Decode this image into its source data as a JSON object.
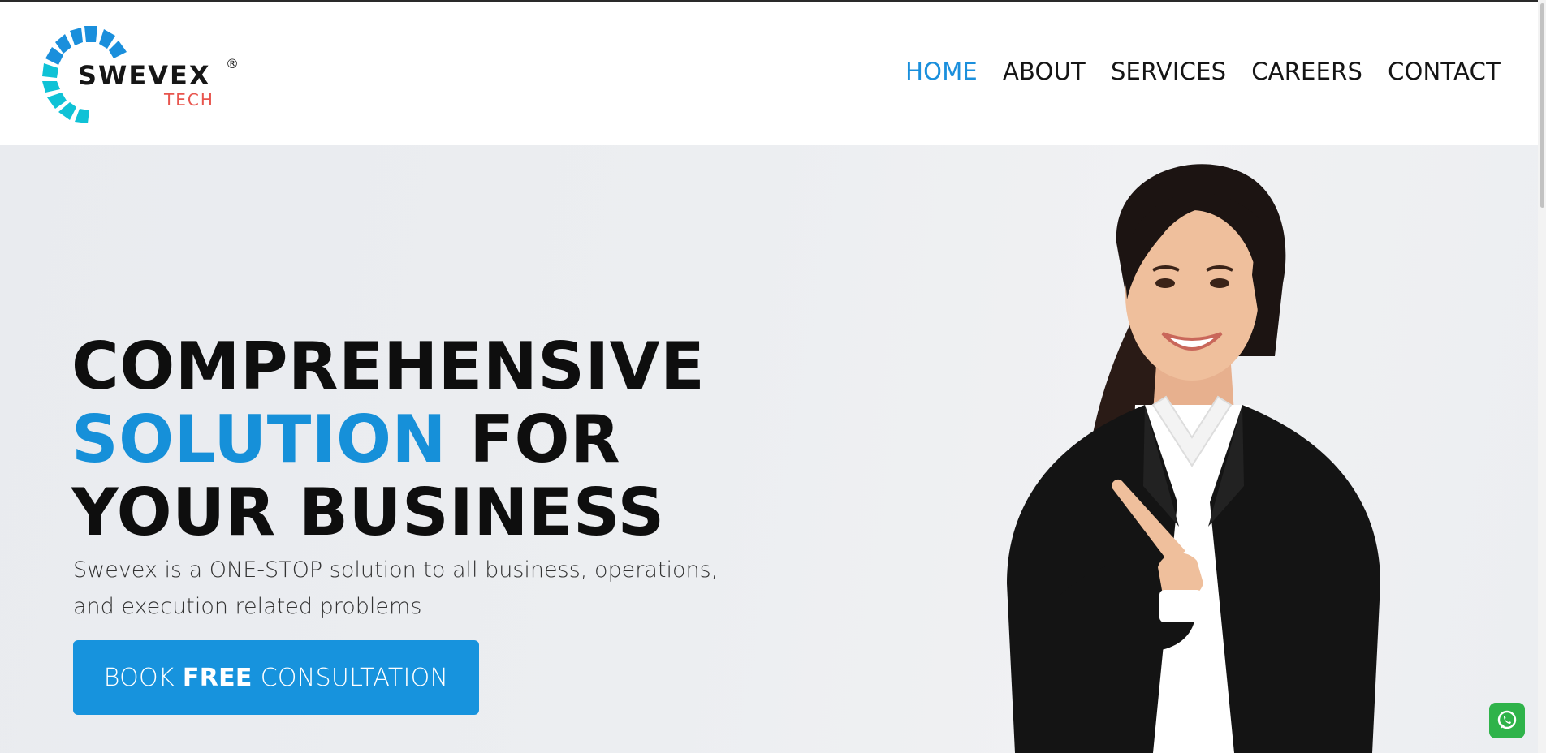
{
  "brand": {
    "name": "SWEVEX",
    "sub": "TECH",
    "registered": "®",
    "colors": {
      "primary": "#1a8fdc",
      "sub": "#e8554e",
      "ring": [
        "#0fc2d6",
        "#1a8fdc"
      ]
    }
  },
  "nav": {
    "items": [
      {
        "label": "HOME",
        "active": true
      },
      {
        "label": "ABOUT",
        "active": false
      },
      {
        "label": "SERVICES",
        "active": false
      },
      {
        "label": "CAREERS",
        "active": false
      },
      {
        "label": "CONTACT",
        "active": false
      }
    ]
  },
  "hero": {
    "headline_line1": "COMPREHENSIVE",
    "headline_accent": "SOLUTION",
    "headline_line2_rest": " FOR",
    "headline_line3": "YOUR BUSINESS",
    "description": "Swevex is a ONE-STOP solution to all business, operations, and execution related problems",
    "cta_prefix": "BOOK",
    "cta_emphasis": "FREE",
    "cta_suffix": "CONSULTATION"
  },
  "icons": {
    "whatsapp": "whatsapp-icon"
  },
  "colors": {
    "accent": "#1690d9",
    "button": "#1793dd",
    "whatsapp": "#2fb34a"
  }
}
